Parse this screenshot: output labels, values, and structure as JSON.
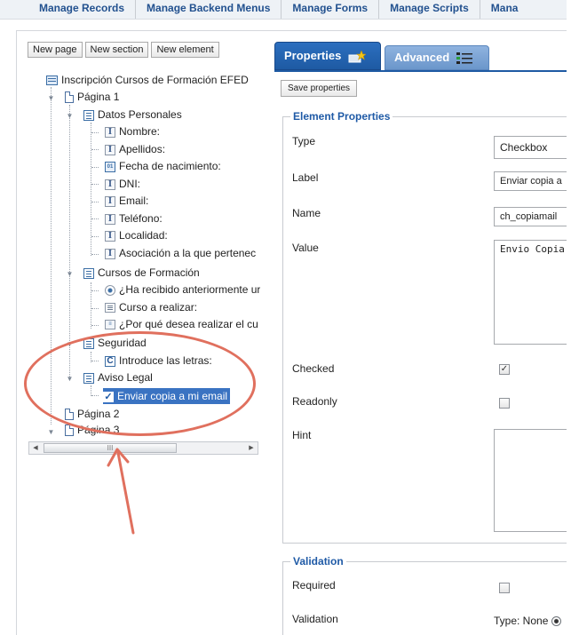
{
  "topnav": {
    "items": [
      "Manage Records",
      "Manage Backend Menus",
      "Manage Forms",
      "Manage Scripts",
      "Mana"
    ]
  },
  "left_panel": {
    "buttons": {
      "new_page": "New page",
      "new_section": "New section",
      "new_element": "New element"
    },
    "tree": {
      "form": "Inscripción Cursos de Formación EFED",
      "page1": "Página 1",
      "datos": "Datos Personales",
      "nombre": "Nombre:",
      "apellidos": "Apellidos:",
      "fecha": "Fecha de nacimiento:",
      "dni": "DNI:",
      "email": "Email:",
      "telefono": "Teléfono:",
      "localidad": "Localidad:",
      "asociacion": "Asociación a la que pertenec",
      "cursos": "Cursos de Formación",
      "recibido": "¿Ha recibido anteriormente ur",
      "curso_realizar": "Curso a realizar:",
      "por_que": "¿Por qué desea realizar el cu",
      "seguridad": "Seguridad",
      "captcha": "Introduce las letras:",
      "aviso": "Aviso Legal",
      "enviar": "Enviar copia a mi email",
      "page2": "Página 2",
      "page3": "Página 3"
    },
    "scroll_grip": "III"
  },
  "right_panel": {
    "tabs": {
      "properties": "Properties",
      "advanced": "Advanced"
    },
    "save_button": "Save properties",
    "element_properties": {
      "legend": "Element Properties",
      "type_label": "Type",
      "type_value": "Checkbox",
      "label_label": "Label",
      "label_value": "Enviar copia a",
      "name_label": "Name",
      "name_value": "ch_copiamail",
      "value_label": "Value",
      "value_value": "Envio Copia",
      "checked_label": "Checked",
      "checked_mark": "✓",
      "readonly_label": "Readonly",
      "hint_label": "Hint"
    },
    "validation": {
      "legend": "Validation",
      "required_label": "Required",
      "validation_label": "Validation",
      "type_text": "Type: None"
    }
  },
  "colors": {
    "accent": "#1f5aa6",
    "annotation": "#e0705e",
    "selection": "#3a73c2"
  }
}
